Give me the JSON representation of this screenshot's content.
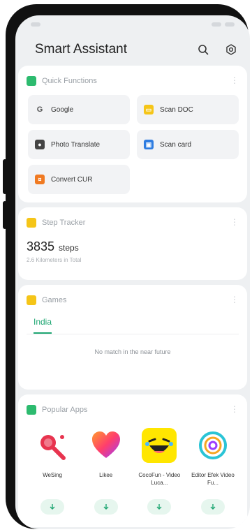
{
  "header": {
    "title": "Smart Assistant"
  },
  "quick_functions": {
    "title": "Quick Functions",
    "items": [
      {
        "label": "Google",
        "icon": "google-icon"
      },
      {
        "label": "Scan DOC",
        "icon": "scan-doc-icon"
      },
      {
        "label": "Photo Translate",
        "icon": "photo-translate-icon"
      },
      {
        "label": "Scan card",
        "icon": "scan-card-icon"
      },
      {
        "label": "Convert CUR",
        "icon": "convert-currency-icon"
      }
    ]
  },
  "step_tracker": {
    "title": "Step Tracker",
    "steps": "3835",
    "unit": "steps",
    "subtitle": "2.6 Kilometers in Total"
  },
  "games": {
    "title": "Games",
    "tab": "India",
    "empty": "No match in the near future"
  },
  "popular_apps": {
    "title": "Popular Apps",
    "apps": [
      {
        "name": "WeSing",
        "icon": "wesing-icon"
      },
      {
        "name": "Likee",
        "icon": "likee-icon"
      },
      {
        "name": "CocoFun - Video Luca...",
        "icon": "cocofun-icon"
      },
      {
        "name": "Editor Efek Video Fu...",
        "icon": "editor-icon"
      }
    ]
  },
  "colors": {
    "accent": "#1ea672",
    "card": "#ffffff",
    "background": "#eef0f2"
  }
}
